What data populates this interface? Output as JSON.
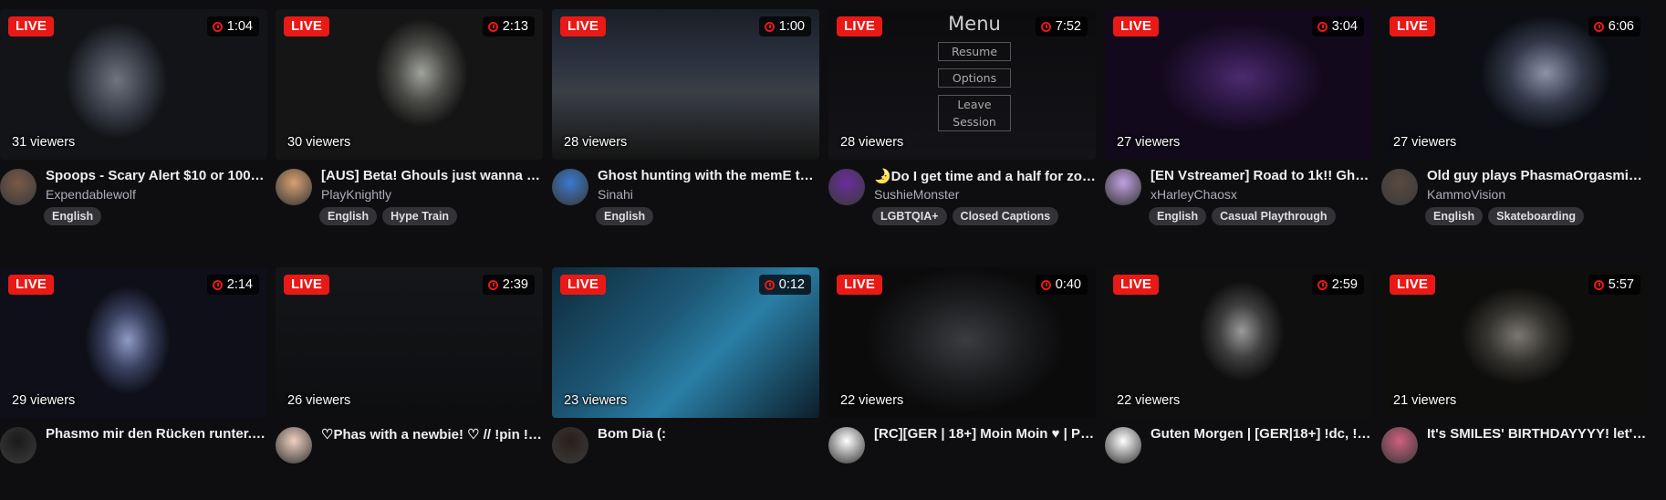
{
  "streams": [
    {
      "live": "LIVE",
      "duration": "1:04",
      "viewers": "31 viewers",
      "title": "Spoops - Scary Alert $10 or 1000...",
      "channel": "Expendablewolf",
      "tags": [
        "English"
      ]
    },
    {
      "live": "LIVE",
      "duration": "2:13",
      "viewers": "30 viewers",
      "title": "[AUS] Beta! Ghouls just wanna ha...",
      "channel": "PlayKnightly",
      "tags": [
        "English",
        "Hype Train"
      ]
    },
    {
      "live": "LIVE",
      "duration": "1:00",
      "viewers": "28 viewers",
      "title": "Ghost hunting with the memE tEam",
      "channel": "Sinahi",
      "tags": [
        "English"
      ]
    },
    {
      "live": "LIVE",
      "duration": "7:52",
      "viewers": "28 viewers",
      "title": "🌛Do I get time and a half for zom...",
      "channel": "SushieMonster",
      "tags": [
        "LGBTQIA+",
        "Closed Captions"
      ],
      "overlay_menu": {
        "title": "Menu",
        "items": [
          "Resume",
          "Options",
          "Leave Session"
        ]
      }
    },
    {
      "live": "LIVE",
      "duration": "3:04",
      "viewers": "27 viewers",
      "title": "[EN Vstreamer] Road to 1k!! Ghost...",
      "channel": "xHarleyChaosx",
      "tags": [
        "English",
        "Casual Playthrough"
      ]
    },
    {
      "live": "LIVE",
      "duration": "6:06",
      "viewers": "27 viewers",
      "title": "Old guy plays PhasmaOrgasmicPh...",
      "channel": "KammoVision",
      "tags": [
        "English",
        "Skateboarding"
      ]
    },
    {
      "live": "LIVE",
      "duration": "2:14",
      "viewers": "29 viewers",
      "title": "Phasmo mir den Rücken runter... !...",
      "channel": "",
      "tags": []
    },
    {
      "live": "LIVE",
      "duration": "2:39",
      "viewers": "26 viewers",
      "title": "♡Phas with a newbie! ♡ // !pin !ge...",
      "channel": "",
      "tags": []
    },
    {
      "live": "LIVE",
      "duration": "0:12",
      "viewers": "23 viewers",
      "title": "Bom Dia (:",
      "channel": "",
      "tags": []
    },
    {
      "live": "LIVE",
      "duration": "0:40",
      "viewers": "22 viewers",
      "title": "[RC][GER | 18+] Moin Moin ♥ | Pha...",
      "channel": "",
      "tags": []
    },
    {
      "live": "LIVE",
      "duration": "2:59",
      "viewers": "22 viewers",
      "title": "Guten Morgen | [GER|18+] !dc, !cl...",
      "channel": "",
      "tags": []
    },
    {
      "live": "LIVE",
      "duration": "5:57",
      "viewers": "21 viewers",
      "title": "It's SMILES' BIRTHDAYYYY! let's g...",
      "channel": "",
      "tags": []
    }
  ],
  "colors": {
    "live_badge": "#e91916",
    "background": "#0e0e10",
    "tag_bg": "#323237"
  },
  "icons": {
    "duration": "clock-icon"
  }
}
